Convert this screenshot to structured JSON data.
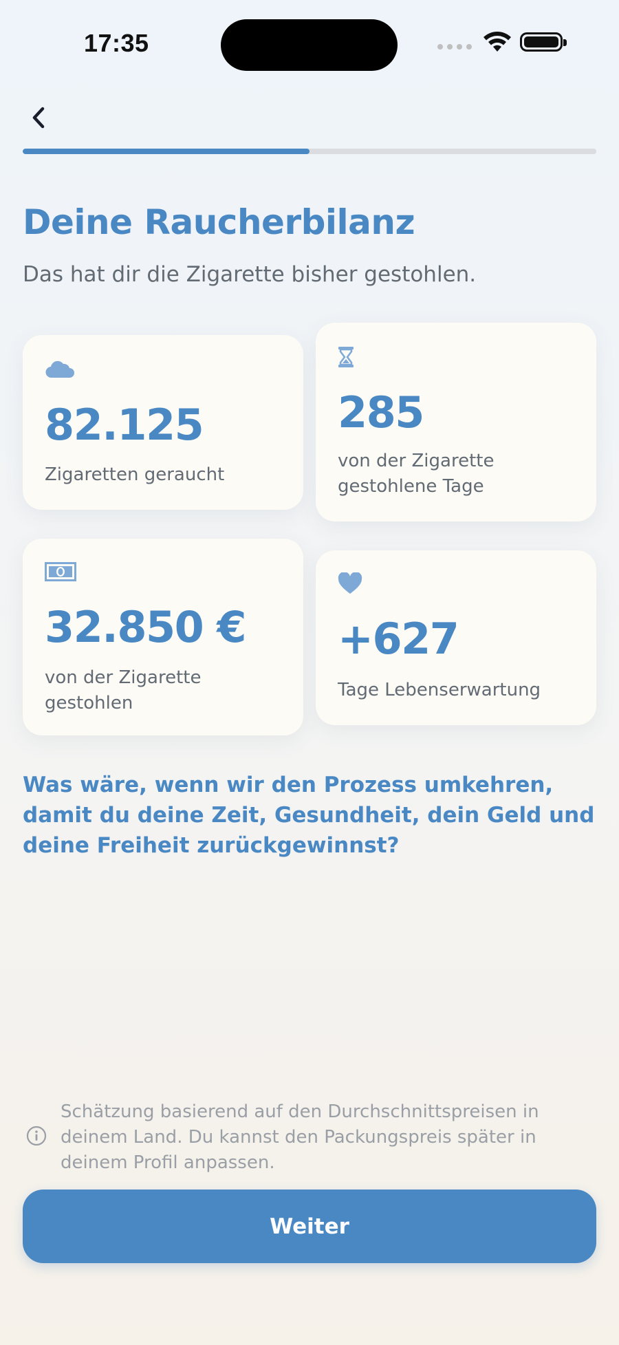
{
  "status_bar": {
    "time": "17:35"
  },
  "nav": {
    "progress_percent": 50
  },
  "header": {
    "title": "Deine Raucherbilanz",
    "subtitle": "Das hat dir die Zigarette bisher gestohlen."
  },
  "stats": [
    {
      "icon": "cloud-icon",
      "value": "82.125",
      "label": "Zigaretten geraucht"
    },
    {
      "icon": "hourglass-icon",
      "value": "285",
      "label": "von der Zigarette gestohlene Tage"
    },
    {
      "icon": "banknote-icon",
      "value": "32.850 €",
      "label": "von der Zigarette gestohlen"
    },
    {
      "icon": "heart-icon",
      "value": "+627",
      "label": "Tage Lebenserwartung"
    }
  ],
  "question": "Was wäre, wenn wir den Prozess umkehren, damit du deine Zeit, Gesundheit, dein Geld und deine Freiheit zurückgewinnst?",
  "disclaimer": "Schätzung basierend auf den Durchschnittspreisen in deinem Land. Du kannst den Packungspreis später in deinem Profil anpassen.",
  "continue_label": "Weiter",
  "colors": {
    "accent": "#4a88c4",
    "card_bg": "#fcfbf6",
    "text_muted": "#626a73"
  }
}
